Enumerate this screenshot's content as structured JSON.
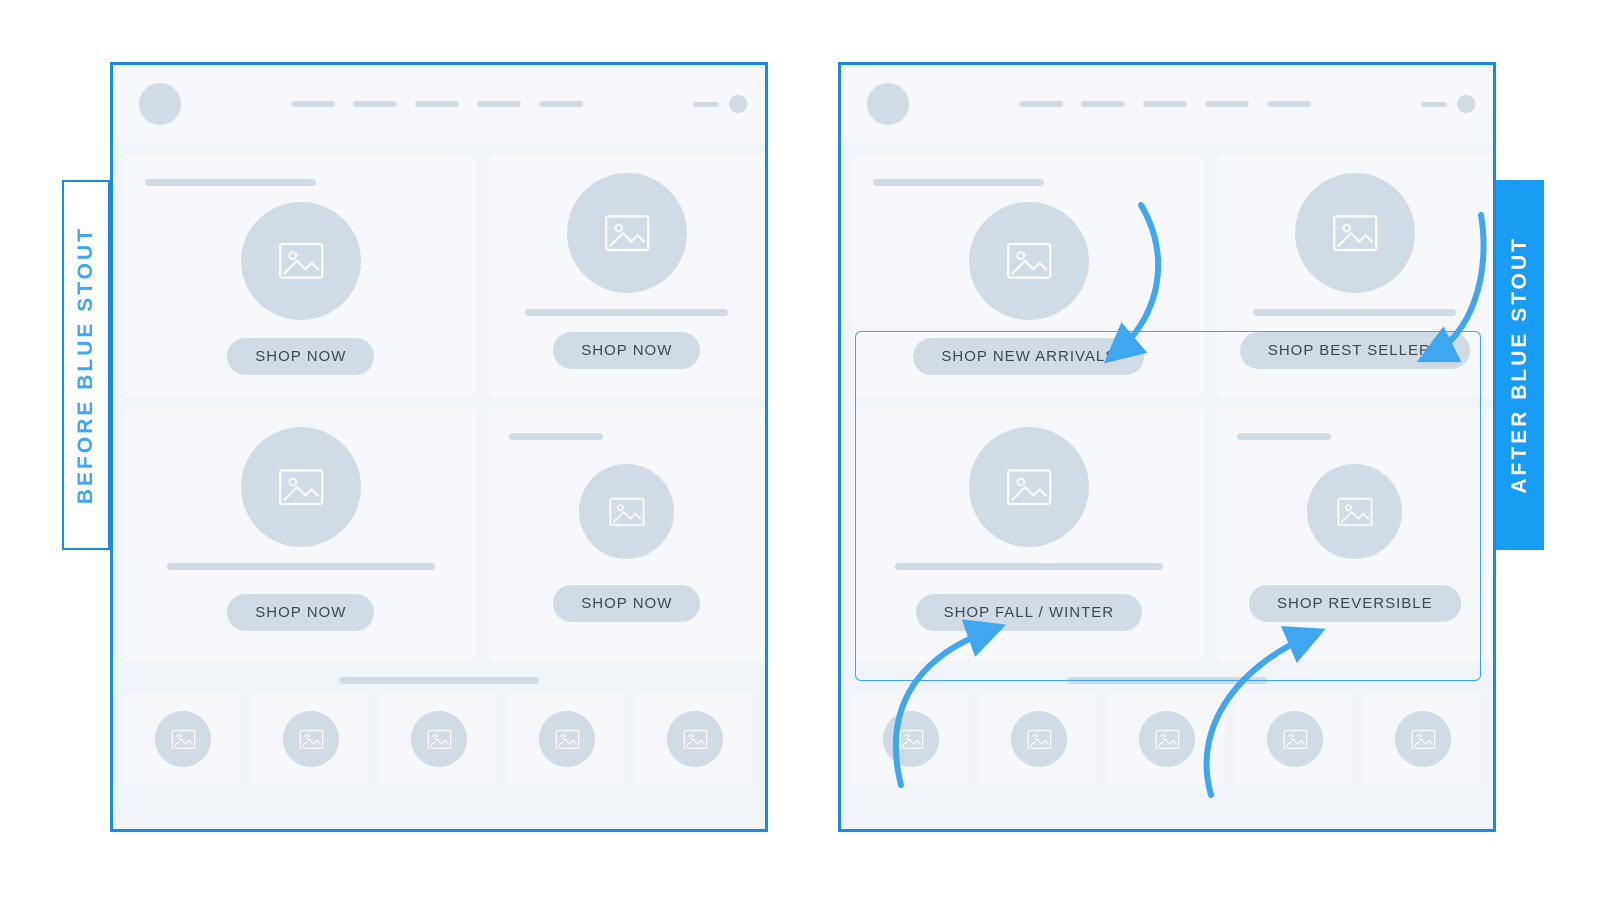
{
  "labels": {
    "before": "BEFORE  BLUE STOUT",
    "after": "AFTER  BLUE STOUT"
  },
  "before": {
    "buttons": [
      "SHOP NOW",
      "SHOP NOW",
      "SHOP NOW",
      "SHOP NOW"
    ]
  },
  "after": {
    "buttons": [
      "SHOP NEW ARRIVALS",
      "SHOP BEST SELLERS",
      "SHOP FALL / WINTER",
      "SHOP REVERSIBLE"
    ]
  },
  "colors": {
    "blue_line": "#1b8be0",
    "blue_fill": "#189cf4",
    "mist": "#d1dbe6",
    "page": "#f1f4f9"
  }
}
